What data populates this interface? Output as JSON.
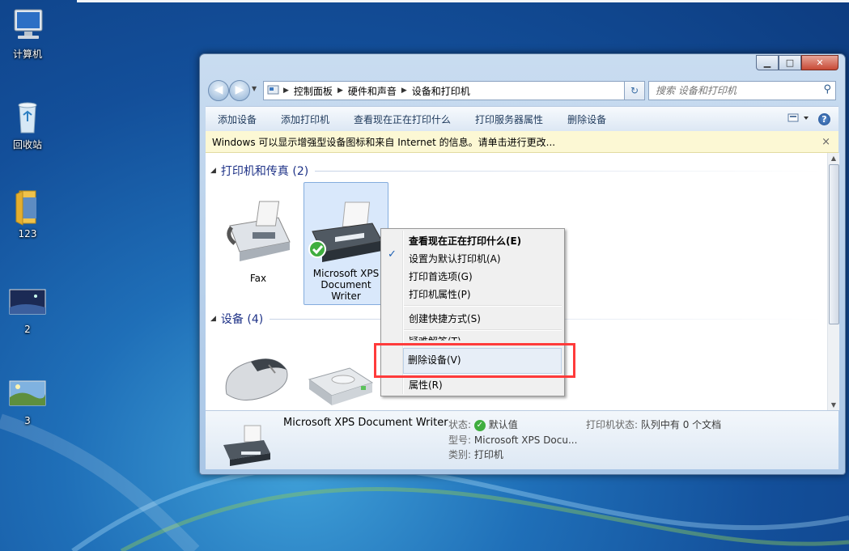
{
  "desktop": {
    "icons": [
      {
        "label": "计算机",
        "icon": "computer-icon"
      },
      {
        "label": "回收站",
        "icon": "recycle-bin-icon"
      },
      {
        "label": "123",
        "icon": "folder-icon"
      },
      {
        "label": "2",
        "icon": "image-thumbnail-icon"
      },
      {
        "label": "3",
        "icon": "image-thumbnail-icon"
      }
    ]
  },
  "window": {
    "address": {
      "segments": [
        "控制面板",
        "硬件和声音",
        "设备和打印机"
      ]
    },
    "search": {
      "placeholder": "搜索 设备和打印机"
    },
    "toolbar": {
      "items": [
        "添加设备",
        "添加打印机",
        "查看现在正在打印什么",
        "打印服务器属性",
        "删除设备"
      ],
      "help": "?"
    },
    "infobar": {
      "text": "Windows 可以显示增强型设备图标和来自 Internet 的信息。请单击进行更改...",
      "close": "×"
    },
    "groups": [
      {
        "title": "打印机和传真 (2)"
      },
      {
        "title": "设备 (4)"
      }
    ],
    "printers": [
      {
        "label": "Fax"
      },
      {
        "label_lines": [
          "Microsoft XPS",
          "Document",
          "Writer"
        ]
      }
    ],
    "details": {
      "name": "Microsoft XPS Document Writer",
      "status_key": "状态:",
      "status_value": "默认值",
      "model_key": "型号:",
      "model_value": "Microsoft XPS Docu...",
      "category_key": "类别:",
      "category_value": "打印机",
      "printer_status_key": "打印机状态:",
      "printer_status_value": "队列中有 0 个文档"
    }
  },
  "context_menu": {
    "items": [
      {
        "label": "查看现在正在打印什么(E)",
        "bold": true
      },
      {
        "label": "设置为默认打印机(A)",
        "checked": true
      },
      {
        "label": "打印首选项(G)"
      },
      {
        "label": "打印机属性(P)"
      },
      {
        "label": "创建快捷方式(S)"
      },
      {
        "label": "疑难解答(T)"
      },
      {
        "label": "删除设备(V)"
      },
      {
        "label": "属性(R)"
      }
    ]
  },
  "colors": {
    "highlight_box": "#ff3b3b",
    "desktop": "#1f6fb8"
  }
}
